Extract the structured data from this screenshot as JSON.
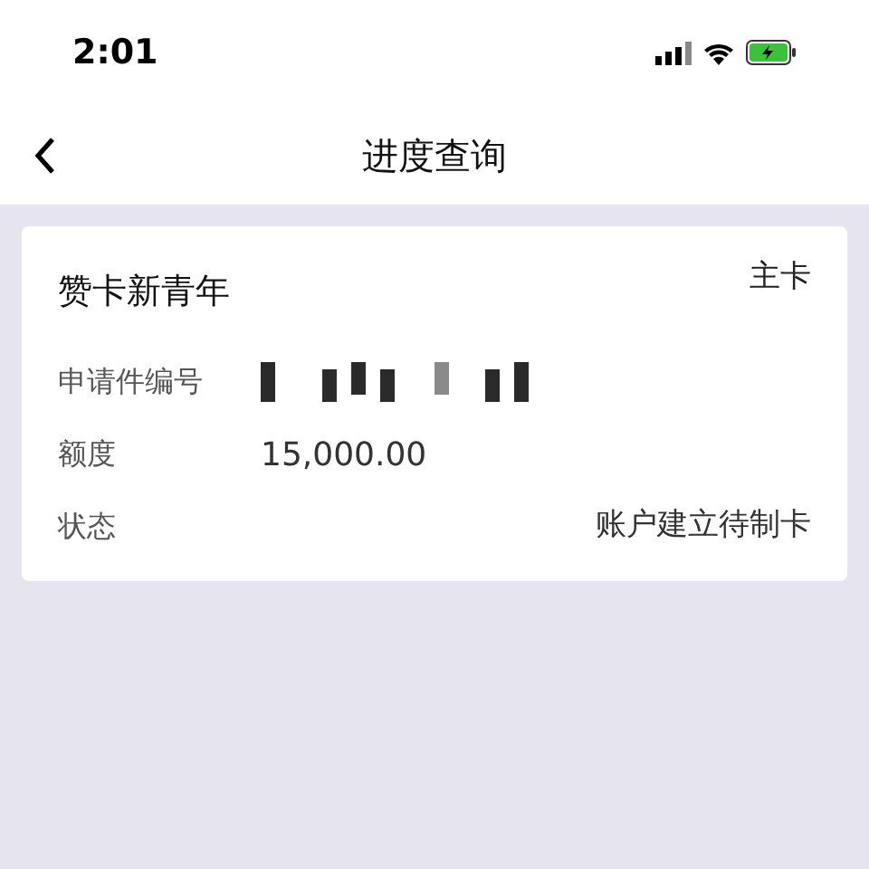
{
  "status_bar": {
    "time": "2:01"
  },
  "nav": {
    "title": "进度查询"
  },
  "card": {
    "name": "赞卡新青年",
    "card_type": "主卡",
    "fields": [
      {
        "kind": "redacted",
        "label": "申请件编号"
      },
      {
        "kind": "text",
        "label": "额度",
        "value": "15,000.00"
      },
      {
        "kind": "status",
        "label": "状态",
        "value": "账户建立待制卡"
      }
    ]
  }
}
